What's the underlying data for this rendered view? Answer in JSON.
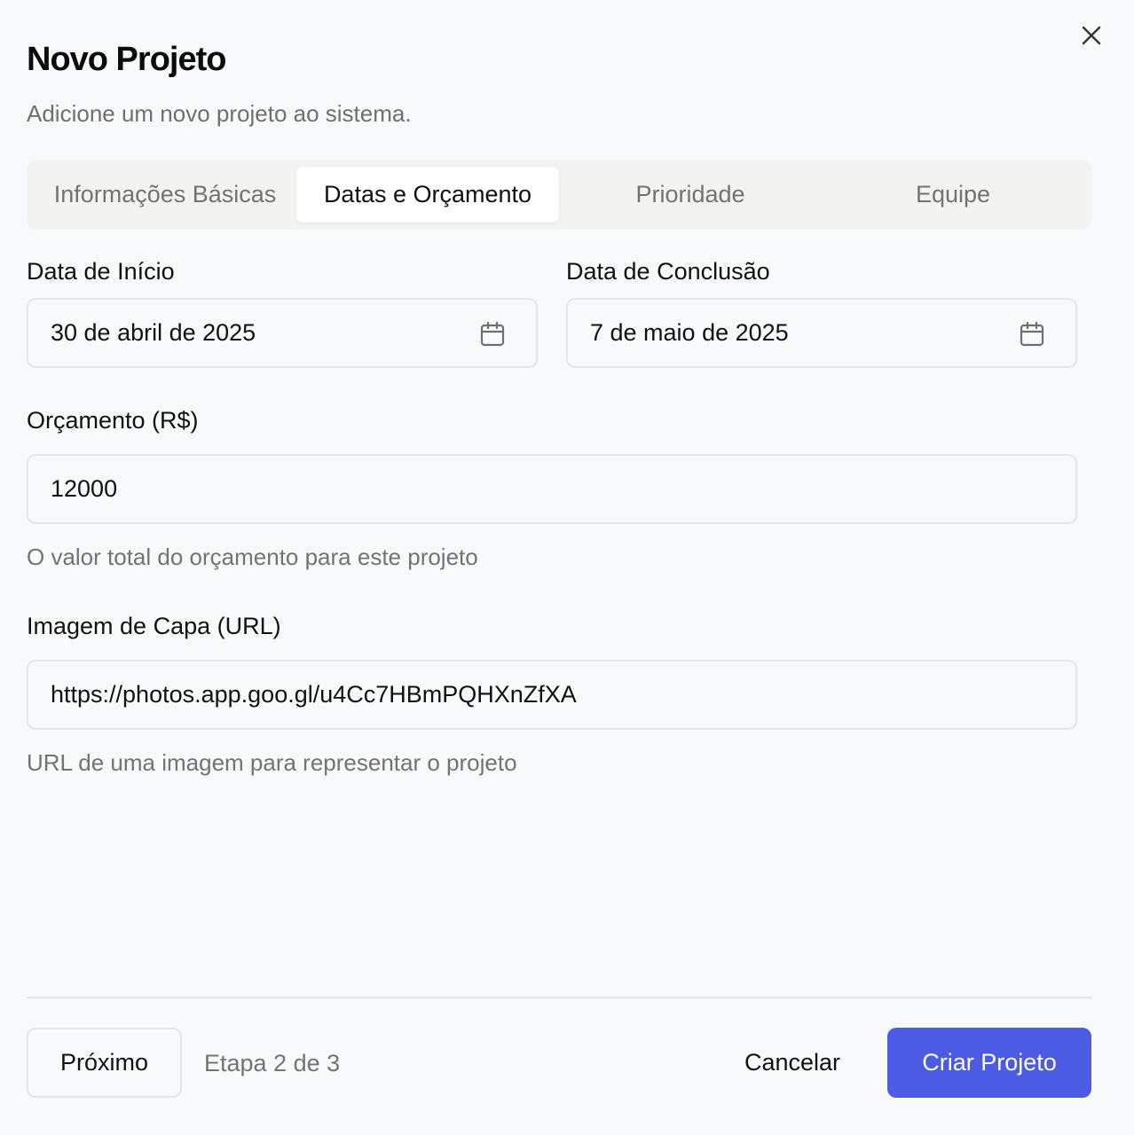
{
  "dialog": {
    "title": "Novo Projeto",
    "subtitle": "Adicione um novo projeto ao sistema.",
    "close_icon": "close-icon"
  },
  "tabs": [
    {
      "label": "Informações Básicas",
      "active": false
    },
    {
      "label": "Datas e Orçamento",
      "active": true
    },
    {
      "label": "Prioridade",
      "active": false
    },
    {
      "label": "Equipe",
      "active": false
    }
  ],
  "form": {
    "start_date": {
      "label": "Data de Início",
      "value": "30 de abril de 2025",
      "icon": "calendar-icon"
    },
    "end_date": {
      "label": "Data de Conclusão",
      "value": "7 de maio de 2025",
      "icon": "calendar-icon"
    },
    "budget": {
      "label": "Orçamento (R$)",
      "value": "12000",
      "help": "O valor total do orçamento para este projeto"
    },
    "cover_image": {
      "label": "Imagem de Capa (URL)",
      "value": "https://photos.app.goo.gl/u4Cc7HBmPQHXnZfXA",
      "help": "URL de uma imagem para representar o projeto"
    }
  },
  "footer": {
    "next_label": "Próximo",
    "step_text": "Etapa 2 de 3",
    "cancel_label": "Cancelar",
    "create_label": "Criar Projeto"
  },
  "colors": {
    "primary": "#4b5be3",
    "background": "#f8f9fa",
    "muted_text": "#737373",
    "border": "#e6e6e6"
  }
}
